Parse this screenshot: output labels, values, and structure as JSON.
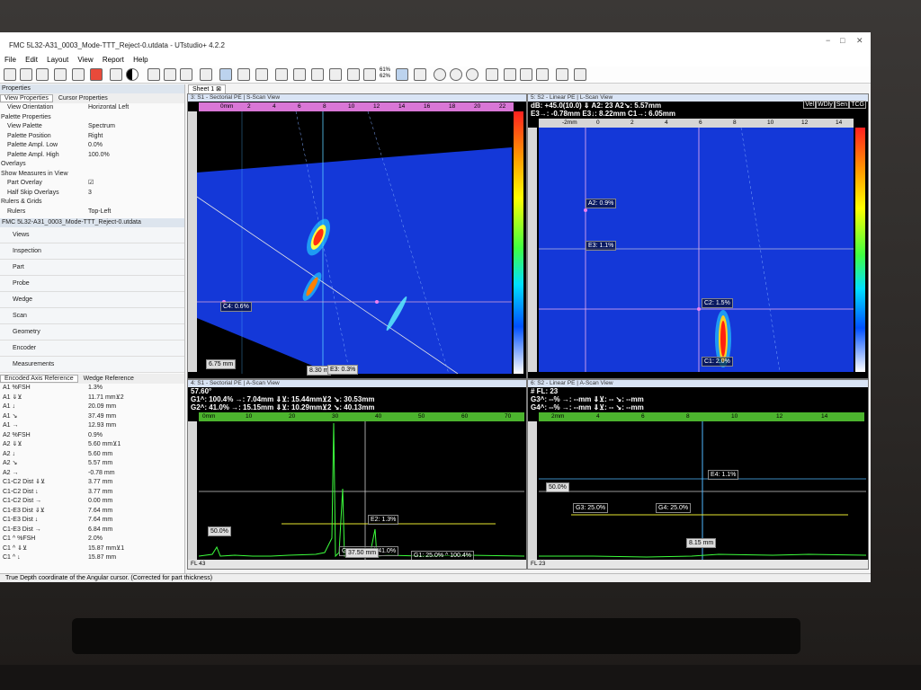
{
  "window": {
    "title": "FMC 5L32-A31_0003_Mode-TTT_Reject-0.utdata - UTstudio+ 4.2.2"
  },
  "menu": [
    "File",
    "Edit",
    "Layout",
    "View",
    "Report",
    "Help"
  ],
  "toolbar": {
    "gain_top": "61%",
    "gain_bottom": "62%"
  },
  "properties_panel": {
    "title": "Properties",
    "tabs": [
      "View Properties",
      "Cursor Properties"
    ],
    "rows": [
      {
        "k": "View Orientation",
        "v": "Horizontal Left"
      },
      {
        "k": "Palette Properties",
        "v": ""
      },
      {
        "k": "View Palette",
        "v": "Spectrum"
      },
      {
        "k": "Palette Position",
        "v": "Right"
      },
      {
        "k": "Palette Ampl. Low",
        "v": "0.0%"
      },
      {
        "k": "Palette Ampl. High",
        "v": "100.0%"
      },
      {
        "k": "Overlays",
        "v": ""
      },
      {
        "k": "Show Measures in View",
        "v": ""
      },
      {
        "k": "Part Overlay",
        "v": "☑"
      },
      {
        "k": "Half Skip Overlays",
        "v": "3"
      },
      {
        "k": "Rulers & Grids",
        "v": ""
      },
      {
        "k": "Rulers",
        "v": "Top-Left"
      }
    ]
  },
  "file_panel": {
    "title": "FMC 5L32-A31_0003_Mode-TTT_Reject-0.utdata",
    "items": [
      "Views",
      "Inspection",
      "Part",
      "Probe",
      "Wedge",
      "Scan",
      "Geometry",
      "Encoder",
      "Measurements"
    ]
  },
  "measurements": {
    "tabs": [
      "Encoded Axis Reference",
      "Wedge Reference"
    ],
    "rows": [
      {
        "k": "A1 %FSH",
        "v": "1.3%"
      },
      {
        "k": "A1 ⇓⊻",
        "v": "11.71 mm⊻2"
      },
      {
        "k": "A1 ↓",
        "v": "20.09 mm"
      },
      {
        "k": "A1 ↘",
        "v": "37.49 mm"
      },
      {
        "k": "A1 →",
        "v": "12.93 mm"
      },
      {
        "k": "A2 %FSH",
        "v": "0.9%"
      },
      {
        "k": "A2 ⇓⊻",
        "v": "5.60 mm⊻1"
      },
      {
        "k": "A2 ↓",
        "v": "5.60 mm"
      },
      {
        "k": "A2 ↘",
        "v": "5.57 mm"
      },
      {
        "k": "A2 →",
        "v": "-0.78 mm"
      },
      {
        "k": "C1-C2 Dist ⇓⊻",
        "v": "3.77 mm"
      },
      {
        "k": "C1-C2 Dist ↓",
        "v": "3.77 mm"
      },
      {
        "k": "C1-C2 Dist →",
        "v": "0.00 mm"
      },
      {
        "k": "C1-E3 Dist ⇓⊻",
        "v": "7.64 mm"
      },
      {
        "k": "C1-E3 Dist ↓",
        "v": "7.64 mm"
      },
      {
        "k": "C1-E3 Dist →",
        "v": "6.84 mm"
      },
      {
        "k": "C1 ^ %FSH",
        "v": "2.0%"
      },
      {
        "k": "C1 ^ ⇓⊻",
        "v": "15.87 mm⊻1"
      },
      {
        "k": "C1 ^ ↓",
        "v": "15.87 mm"
      }
    ]
  },
  "status_text": "True Depth coordinate of the Angular cursor. (Corrected for part thickness)",
  "sheet_tab": "Sheet 1",
  "view3": {
    "header": "3: S1 - Sectorial PE | S-Scan View",
    "ruler_unit": "0mm",
    "ruler_ticks": [
      "2",
      "4",
      "6",
      "8",
      "10",
      "12",
      "14",
      "16",
      "18",
      "20",
      "22"
    ],
    "labels": {
      "c4": "C4: 0.6%",
      "depth": "6.75 mm",
      "pos": "8.30 m",
      "e3": "E3: 0.3%"
    }
  },
  "view5": {
    "header": "5: S2 - Linear PE | L-Scan View",
    "readout1": "dB: +45.0(10.0)   ⇓ A2: 23        A2↘: 5.57mm",
    "readout2": "E3→: -0.78mm      E3↓: 8.22mm     C1→: 6.05mm",
    "buttons": [
      "Vel",
      "WDly",
      "Sen",
      "TCG"
    ],
    "ruler_ticks": [
      "-2mm",
      "0",
      "2",
      "4",
      "6",
      "8",
      "10",
      "12",
      "14"
    ],
    "labels": {
      "a2": "A2: 0.9%",
      "e3": "E3: 1.1%",
      "c2": "C2: 1.5%",
      "c1": "C1: 2.0%"
    }
  },
  "view4": {
    "header": "4: S1 - Sectorial PE | A-Scan View",
    "angle": "57.60°",
    "readout1": "G1^: 100.4%   →: 7.04mm   ⇓⊻: 15.44mm⊻2    ↘: 30.53mm",
    "readout2": "G2^: 41.0%    →: 15.15mm  ⇓⊻: 10.29mm⊻2    ↘: 40.13mm",
    "ruler_ticks": [
      "0mm",
      "10",
      "20",
      "30",
      "40",
      "50",
      "60",
      "70"
    ],
    "labels": {
      "e2": "E2: 1.3%",
      "level": "50.0%",
      "g2": "G2: 25.0% ^ 41.0%",
      "g1": "G1: 25.0% ^ 100.4%",
      "pos": "37.50 mm"
    },
    "fl": "FL  43"
  },
  "view6": {
    "header": "6: S2 - Linear PE | A-Scan View",
    "readout0": "# FL: 23",
    "readout1": "G3^: --%       →: --mm     ⇓⊻: --          ↘: --mm",
    "readout2": "G4^: --%       →: --mm     ⇓⊻: --          ↘: --mm",
    "ruler_ticks": [
      "2mm",
      "4",
      "6",
      "8",
      "10",
      "12",
      "14"
    ],
    "labels": {
      "e4": "E4: 1.1%",
      "level": "50.0%",
      "g3": "G3: 25.0%",
      "g4": "G4: 25.0%",
      "pos": "8.15 mm"
    },
    "fl": "FL  23"
  },
  "colors": {
    "pink_ruler": "#d977d6",
    "green_ruler": "#4cb42e",
    "scan_blue": "#1438d8"
  }
}
